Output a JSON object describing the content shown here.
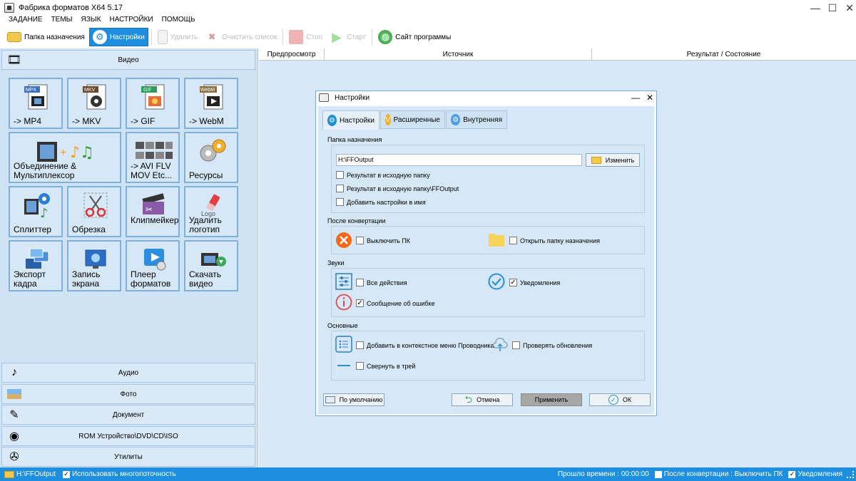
{
  "window": {
    "title": "Фабрика форматов X64 5.17",
    "minimize": "—",
    "maximize": "☐",
    "close": "✕"
  },
  "menu": [
    "ЗАДАНИЕ",
    "ТЕМЫ",
    "ЯЗЫК",
    "НАСТРОЙКИ",
    "ПОМОЩЬ"
  ],
  "toolbar": {
    "dest_folder": "Папка назначения",
    "settings": "Настройки",
    "delete": "Удалить",
    "clear_list": "Очистить список",
    "stop": "Стоп",
    "start": "Старт",
    "website": "Сайт программы"
  },
  "left": {
    "video_header": "Видео",
    "tiles": [
      {
        "label": "-> MP4",
        "badge": "MP4"
      },
      {
        "label": "-> MKV",
        "badge": "MKV"
      },
      {
        "label": "-> GIF",
        "badge": "GIF"
      },
      {
        "label": "-> WebM",
        "badge": "WebM"
      },
      {
        "label": "Объединение &\nМультиплексор"
      },
      {
        "label": "-> AVI FLV\nMOV Etc..."
      },
      {
        "label": "Ресурсы"
      },
      {
        "label": "Сплиттер"
      },
      {
        "label": "Обрезка"
      },
      {
        "label": "Клипмейкер"
      },
      {
        "label": "Удалить\nлоготип",
        "badge": "Logo"
      },
      {
        "label": "Экспорт\nкадра"
      },
      {
        "label": "Запись\nэкрана"
      },
      {
        "label": "Плеер\nформатов"
      },
      {
        "label": "Скачать\nвидео"
      }
    ],
    "bottom_categories": [
      "Аудио",
      "Фото",
      "Документ",
      "ROM Устройство\\DVD\\CD\\ISO",
      "Утилиты"
    ]
  },
  "columns": {
    "preview": "Предпросмотр",
    "source": "Источник",
    "result": "Результат / Состояние"
  },
  "dialog": {
    "title": "Настройки",
    "tabs": [
      "Настройки",
      "Расширенные",
      "Внутренняя"
    ],
    "dest_section": "Папка назначения",
    "path": "H:\\FFOutput",
    "change_btn": "Изменить",
    "dest_options": [
      {
        "label": "Результат в исходную папку",
        "checked": false
      },
      {
        "label": "Результат в исходную папку\\FFOutput",
        "checked": false
      },
      {
        "label": "Добавить настройки в имя",
        "checked": false
      }
    ],
    "after_section": "После конвертации",
    "shutdown": "Выключить ПК",
    "open_folder": "Открыть папку назначения",
    "sounds_section": "Звуки",
    "all_actions": "Все действия",
    "notifications": "Уведомления",
    "error_message": "Сообщение об ошибке",
    "basic_section": "Основные",
    "context_menu": "Добавить в контекстное меню Проводника",
    "check_updates": "Проверять обновления",
    "minimize_tray": "Свернуть в трей",
    "btn_default": "По умолчанию",
    "btn_cancel": "Отмена",
    "btn_apply": "Применить",
    "btn_ok": "ОК"
  },
  "status": {
    "path": "H:\\FFOutput",
    "multithread": "Использовать многопоточность",
    "elapsed": "Прошло времени : 00:00:00",
    "after_conv": "После конвертации : Выключить ПК",
    "notifications": "Уведомления"
  },
  "colors": {
    "accent": "#1e8fe0",
    "panel": "#cfe3f5",
    "tile_border": "#7fb1e0"
  }
}
